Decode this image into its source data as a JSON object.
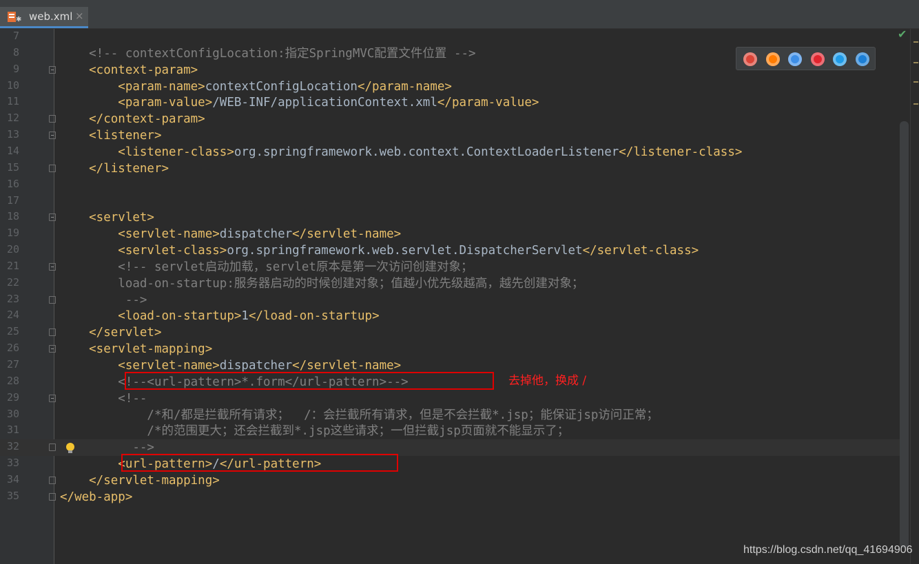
{
  "tab": {
    "label": "web.xml",
    "close": "×"
  },
  "lines": [
    {
      "n": "7",
      "fold": "",
      "segs": []
    },
    {
      "n": "8",
      "fold": "",
      "segs": [
        [
          "c",
          "    <!-- contextConfigLocation:指定SpringMVC配置文件位置 -->"
        ]
      ]
    },
    {
      "n": "9",
      "fold": "open",
      "segs": [
        [
          "t",
          "    <context-param>"
        ]
      ]
    },
    {
      "n": "10",
      "fold": "",
      "segs": [
        [
          "t",
          "        <param-name>"
        ],
        [
          "x",
          "contextConfigLocation"
        ],
        [
          "t",
          "</param-name>"
        ]
      ]
    },
    {
      "n": "11",
      "fold": "",
      "segs": [
        [
          "t",
          "        <param-value>"
        ],
        [
          "x",
          "/WEB-INF/applicationContext.xml"
        ],
        [
          "t",
          "</param-value>"
        ]
      ]
    },
    {
      "n": "12",
      "fold": "close",
      "segs": [
        [
          "t",
          "    </context-param>"
        ]
      ]
    },
    {
      "n": "13",
      "fold": "open",
      "segs": [
        [
          "t",
          "    <listener>"
        ]
      ]
    },
    {
      "n": "14",
      "fold": "",
      "segs": [
        [
          "t",
          "        <listener-class>"
        ],
        [
          "x",
          "org.springframework.web.context.ContextLoaderListener"
        ],
        [
          "t",
          "</listener-class>"
        ]
      ]
    },
    {
      "n": "15",
      "fold": "close",
      "segs": [
        [
          "t",
          "    </listener>"
        ]
      ]
    },
    {
      "n": "16",
      "fold": "",
      "segs": []
    },
    {
      "n": "17",
      "fold": "",
      "segs": []
    },
    {
      "n": "18",
      "fold": "open",
      "segs": [
        [
          "t",
          "    <servlet>"
        ]
      ]
    },
    {
      "n": "19",
      "fold": "",
      "segs": [
        [
          "t",
          "        <servlet-name>"
        ],
        [
          "x",
          "dispatcher"
        ],
        [
          "t",
          "</servlet-name>"
        ]
      ]
    },
    {
      "n": "20",
      "fold": "",
      "segs": [
        [
          "t",
          "        <servlet-class>"
        ],
        [
          "x",
          "org.springframework.web.servlet.DispatcherServlet"
        ],
        [
          "t",
          "</servlet-class>"
        ]
      ]
    },
    {
      "n": "21",
      "fold": "open",
      "segs": [
        [
          "c",
          "        <!-- servlet启动加载，servlet原本是第一次访问创建对象；"
        ]
      ]
    },
    {
      "n": "22",
      "fold": "",
      "segs": [
        [
          "c",
          "        load-on-startup:服务器启动的时候创建对象；值越小优先级越高，越先创建对象；"
        ]
      ]
    },
    {
      "n": "23",
      "fold": "close",
      "segs": [
        [
          "c",
          "         -->"
        ]
      ]
    },
    {
      "n": "24",
      "fold": "",
      "segs": [
        [
          "t",
          "        <load-on-startup>"
        ],
        [
          "x",
          "1"
        ],
        [
          "t",
          "</load-on-startup>"
        ]
      ]
    },
    {
      "n": "25",
      "fold": "close",
      "segs": [
        [
          "t",
          "    </servlet>"
        ]
      ]
    },
    {
      "n": "26",
      "fold": "open",
      "segs": [
        [
          "t",
          "    <servlet-mapping>"
        ]
      ]
    },
    {
      "n": "27",
      "fold": "",
      "segs": [
        [
          "t",
          "        <servlet-name>"
        ],
        [
          "x",
          "dispatcher"
        ],
        [
          "t",
          "</servlet-name>"
        ]
      ]
    },
    {
      "n": "28",
      "fold": "",
      "segs": [
        [
          "c",
          "        <!--<url-pattern>*.form</url-pattern>-->"
        ]
      ]
    },
    {
      "n": "29",
      "fold": "open",
      "segs": [
        [
          "c",
          "        <!--"
        ]
      ]
    },
    {
      "n": "30",
      "fold": "",
      "segs": [
        [
          "c",
          "            /*和/都是拦截所有请求；  /：会拦截所有请求，但是不会拦截*.jsp；能保证jsp访问正常；"
        ]
      ]
    },
    {
      "n": "31",
      "fold": "",
      "segs": [
        [
          "c",
          "            /*的范围更大；还会拦截到*.jsp这些请求；一但拦截jsp页面就不能显示了；"
        ]
      ]
    },
    {
      "n": "32",
      "fold": "close",
      "current": true,
      "bulb": true,
      "segs": [
        [
          "c",
          "          -->"
        ]
      ]
    },
    {
      "n": "33",
      "fold": "",
      "segs": [
        [
          "t",
          "        <url-pattern>"
        ],
        [
          "x",
          "/"
        ],
        [
          "t",
          "</url-pattern>"
        ]
      ]
    },
    {
      "n": "34",
      "fold": "close",
      "segs": [
        [
          "t",
          "    </servlet-mapping>"
        ]
      ]
    },
    {
      "n": "35",
      "fold": "close",
      "segs": [
        [
          "t",
          "</web-app>"
        ]
      ]
    }
  ],
  "annotation": "去掉他，换成 /",
  "browsers": [
    {
      "name": "chrome-icon",
      "color": "#db4437"
    },
    {
      "name": "firefox-icon",
      "color": "#ff7b00"
    },
    {
      "name": "safari-icon",
      "color": "#3d8ee6"
    },
    {
      "name": "opera-icon",
      "color": "#e0242e"
    },
    {
      "name": "ie-icon",
      "color": "#1f9be8"
    },
    {
      "name": "edge-icon",
      "color": "#1c7fd6"
    }
  ],
  "watermark": "https://blog.csdn.net/qq_41694906",
  "colors": {
    "tag": "#e8bf6a",
    "comment": "#808080",
    "text": "#a9b7c6",
    "accent": "#4a88c7"
  }
}
